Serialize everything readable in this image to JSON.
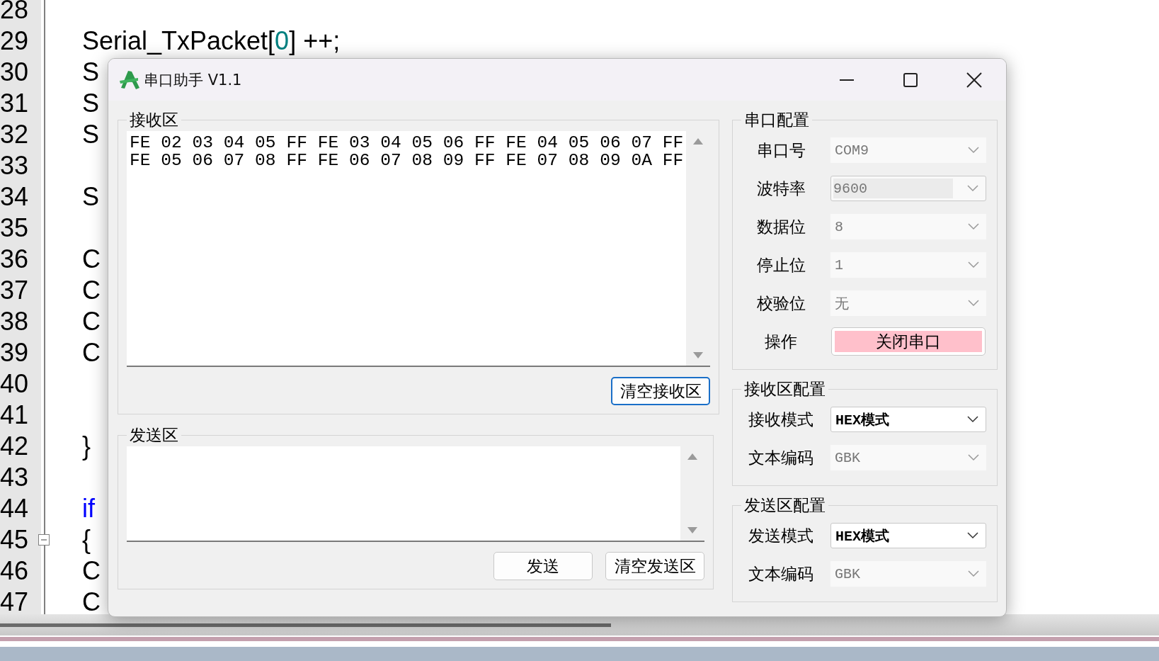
{
  "editor": {
    "lines": [
      {
        "number": "28"
      },
      {
        "number": "29",
        "tokens": [
          {
            "text": "Serial_TxPacket[",
            "kind": "plain"
          },
          {
            "text": "0",
            "kind": "number"
          },
          {
            "text": "] ++;",
            "kind": "plain"
          }
        ]
      },
      {
        "number": "30",
        "tokens": [
          {
            "text": "S",
            "kind": "plain"
          }
        ]
      },
      {
        "number": "31",
        "tokens": [
          {
            "text": "S",
            "kind": "plain"
          }
        ]
      },
      {
        "number": "32",
        "tokens": [
          {
            "text": "S",
            "kind": "plain"
          }
        ]
      },
      {
        "number": "33"
      },
      {
        "number": "34",
        "tokens": [
          {
            "text": "S",
            "kind": "plain"
          }
        ]
      },
      {
        "number": "35"
      },
      {
        "number": "36",
        "tokens": [
          {
            "text": "C",
            "kind": "plain"
          }
        ]
      },
      {
        "number": "37",
        "tokens": [
          {
            "text": "C",
            "kind": "plain"
          }
        ]
      },
      {
        "number": "38",
        "tokens": [
          {
            "text": "C",
            "kind": "plain"
          }
        ]
      },
      {
        "number": "39",
        "tokens": [
          {
            "text": "C",
            "kind": "plain"
          }
        ]
      },
      {
        "number": "40"
      },
      {
        "number": "41"
      },
      {
        "number": "42",
        "tokens": [
          {
            "text": "}",
            "kind": "plain"
          }
        ]
      },
      {
        "number": "43"
      },
      {
        "number": "44",
        "tokens": [
          {
            "text": "if",
            "kind": "keyword"
          }
        ]
      },
      {
        "number": "45",
        "folded": false,
        "tokens": [
          {
            "text": "{",
            "kind": "plain"
          }
        ]
      },
      {
        "number": "46",
        "tokens": [
          {
            "text": "C",
            "kind": "plain"
          }
        ]
      },
      {
        "number": "47",
        "tokens": [
          {
            "text": "C",
            "kind": "plain"
          }
        ]
      }
    ]
  },
  "window": {
    "title": "串口助手 V1.1"
  },
  "receive": {
    "label": "接收区",
    "lines": [
      "FE 02 03 04 05 FF FE 03 04 05 06 FF FE 04 05 06 07 FF",
      "FE 05 06 07 08 FF FE 06 07 08 09 FF FE 07 08 09 0A FF"
    ],
    "buttons": [
      {
        "label": "清空接收区",
        "focused": true
      }
    ]
  },
  "send": {
    "label": "发送区",
    "buttons": [
      {
        "label": "发送",
        "focused": false
      },
      {
        "label": "清空发送区",
        "focused": false
      }
    ]
  },
  "config_groups": [
    {
      "title": "串口配置",
      "fields": [
        {
          "label": "串口号",
          "value": "COM9",
          "kind": "combo",
          "disabled": true
        },
        {
          "label": "波特率",
          "value": "9600",
          "kind": "editable",
          "disabled": true
        },
        {
          "label": "数据位",
          "value": "8",
          "kind": "combo",
          "disabled": true
        },
        {
          "label": "停止位",
          "value": "1",
          "kind": "combo",
          "disabled": true
        },
        {
          "label": "校验位",
          "value": "无",
          "kind": "combo",
          "disabled": true
        },
        {
          "label": "操作",
          "value": "关闭串口",
          "kind": "button"
        }
      ]
    },
    {
      "title": "接收区配置",
      "fields": [
        {
          "label": "接收模式",
          "value": "HEX模式",
          "kind": "combo",
          "disabled": false
        },
        {
          "label": "文本编码",
          "value": "GBK",
          "kind": "combo",
          "disabled": true
        }
      ]
    },
    {
      "title": "发送区配置",
      "fields": [
        {
          "label": "发送模式",
          "value": "HEX模式",
          "kind": "combo",
          "disabled": false
        },
        {
          "label": "文本编码",
          "value": "GBK",
          "kind": "combo",
          "disabled": true
        }
      ]
    }
  ]
}
